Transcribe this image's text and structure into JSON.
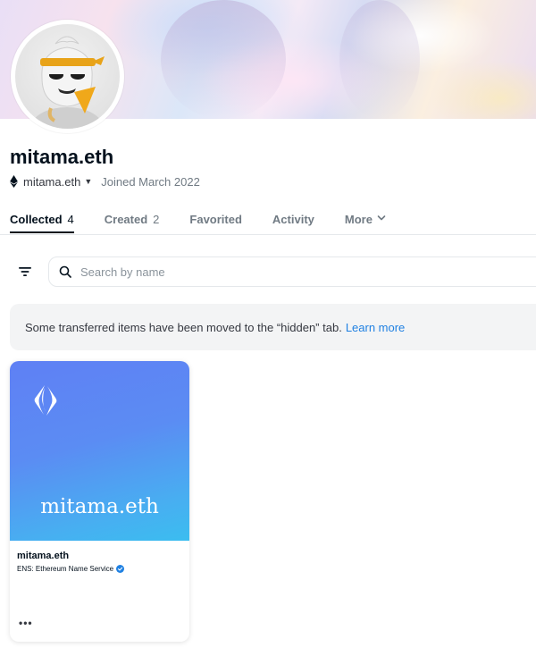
{
  "profile": {
    "name": "mitama.eth",
    "address": "mitama.eth",
    "joined": "Joined March 2022"
  },
  "tabs": [
    {
      "label": "Collected",
      "count": "4"
    },
    {
      "label": "Created",
      "count": "2"
    },
    {
      "label": "Favorited"
    },
    {
      "label": "Activity"
    },
    {
      "label": "More"
    }
  ],
  "search": {
    "placeholder": "Search by name",
    "value": ""
  },
  "notice": {
    "text": "Some transferred items have been moved to the “hidden” tab.",
    "link": "Learn more"
  },
  "card": {
    "media_text": "mitama.eth",
    "title": "mitama.eth",
    "collection": "ENS: Ethereum Name Service",
    "more_label": "•••"
  },
  "colors": {
    "accent": "#2081e2",
    "text_primary": "#04111d",
    "text_secondary": "#707a83",
    "card_gradient_start": "#5f80f4",
    "card_gradient_end": "#3bbdf0"
  },
  "icons": {
    "eth": "ethereum-icon",
    "filter": "filter-icon",
    "search": "search-icon",
    "verified": "verified-badge-icon",
    "ens": "ens-logo-icon"
  }
}
